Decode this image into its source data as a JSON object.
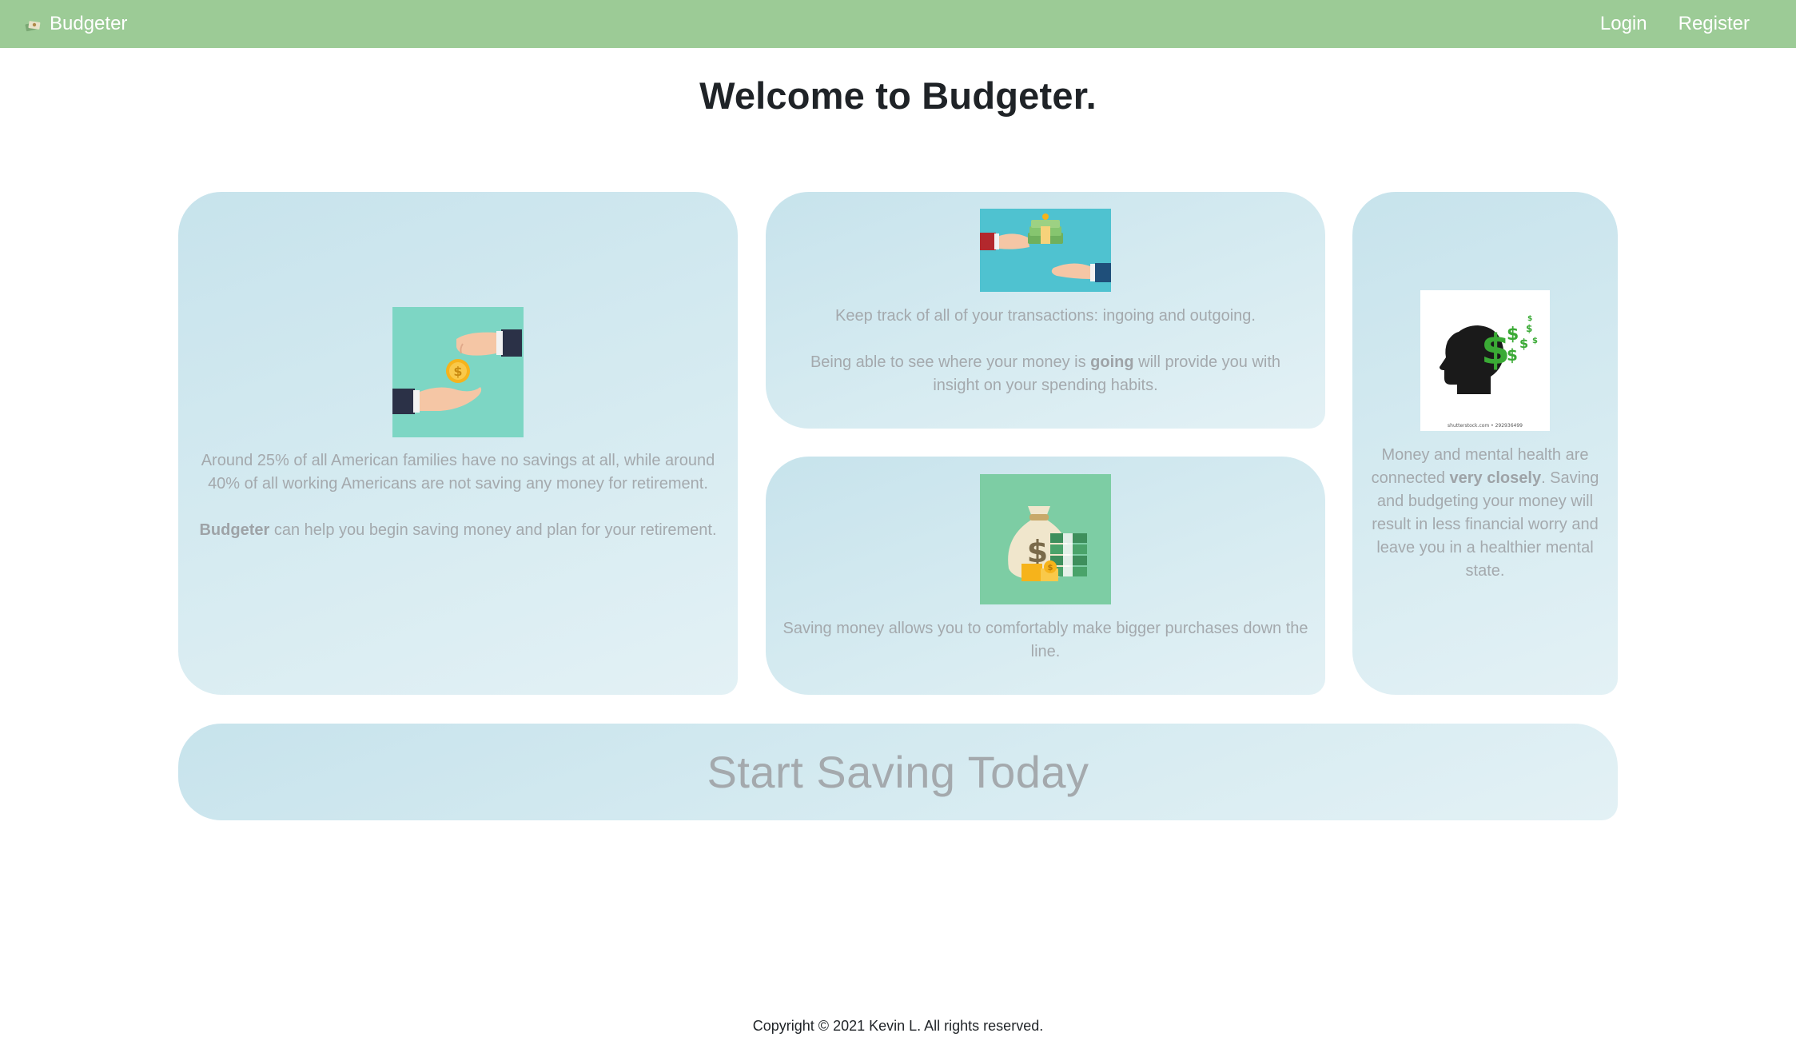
{
  "navbar": {
    "brand": "Budgeter",
    "brand_icon": "money-bag-icon",
    "links": [
      "Login",
      "Register"
    ]
  },
  "page": {
    "title": "Welcome to Budgeter."
  },
  "cards": {
    "left": {
      "image": "hand-giving-coin-icon",
      "p1": "Around 25% of all American families have no savings at all, while around 40% of all working Americans are not saving any money for retirement.",
      "p2_strong": "Budgeter",
      "p2_rest": " can help you begin saving money and plan for your retirement."
    },
    "mid_top": {
      "image": "hands-passing-cash-icon",
      "p1": "Keep track of all of your transactions: ingoing and outgoing.",
      "p2_before": "Being able to see where your money is ",
      "p2_strong": "going",
      "p2_after": " will provide you with insight on your spending habits."
    },
    "mid_bottom": {
      "image": "money-bag-and-cash-icon",
      "p1": "Saving money allows you to comfortably make bigger purchases down the line."
    },
    "right": {
      "image": "head-with-dollar-signs-icon",
      "image_watermark": "shutterstock.com • 292936499",
      "p1_before": "Money and mental health are connected ",
      "p1_strong": "very closely",
      "p1_after": ". Saving and budgeting your money will result in less financial worry and leave you in a healthier mental state."
    }
  },
  "cta": {
    "label": "Start Saving Today"
  },
  "footer": {
    "copyright": "Copyright © 2021 Kevin L. All rights reserved."
  },
  "colors": {
    "navbar": "#9ccb96",
    "card_gradient_start": "#c7e3ec",
    "card_gradient_end": "#e3f1f5",
    "card_text": "#a4a9ad",
    "title_text": "#1f2327"
  }
}
